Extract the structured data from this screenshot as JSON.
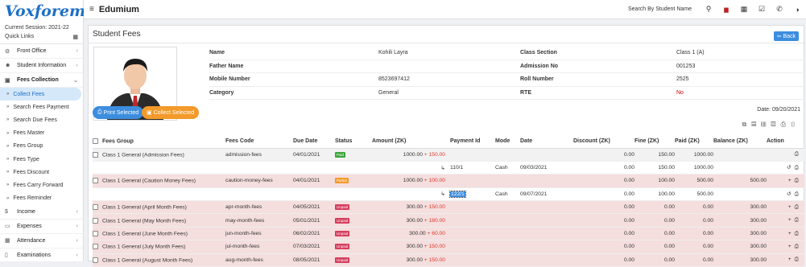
{
  "brand": {
    "logo": "Voxforem",
    "session": "Current Session: 2021-22",
    "quick_links": "Quick Links"
  },
  "sidebar": {
    "items": [
      {
        "label": "Front Office",
        "icon": "briefcase-icon"
      },
      {
        "label": "Student Information",
        "icon": "user-icon"
      },
      {
        "label": "Fees Collection",
        "icon": "money-icon"
      }
    ],
    "sub": [
      "Collect Fees",
      "Search Fees Payment",
      "Search Due Fees",
      "Fees Master",
      "Fees Group",
      "Fees Type",
      "Fees Discount",
      "Fees Carry Forward",
      "Fees Reminder"
    ],
    "more": [
      {
        "label": "Income",
        "icon": "dollar-icon"
      },
      {
        "label": "Expenses",
        "icon": "credit-card-icon"
      },
      {
        "label": "Attendance",
        "icon": "calendar-icon"
      },
      {
        "label": "Examinations",
        "icon": "book-icon"
      }
    ]
  },
  "topbar": {
    "app_name": "Edumium",
    "search": "Search By Student Name"
  },
  "panel": {
    "title": "Student Fees",
    "back": "Back",
    "print_selected": "Print Selected",
    "collect_selected": "Collect Selected",
    "date": "Date: 09/20/2021"
  },
  "student": [
    [
      "Name",
      "Kohili Layra",
      "Class Section",
      "Class 1 (A)"
    ],
    [
      "Father Name",
      "",
      "Admission No",
      "001253"
    ],
    [
      "Mobile Number",
      "8523697412",
      "Roll Number",
      "2525"
    ],
    [
      "Category",
      "General",
      "RTE",
      "No"
    ]
  ],
  "table": {
    "headers": [
      "Fees Group",
      "Fees Code",
      "Due Date",
      "Status",
      "Amount (ZK)",
      "Payment Id",
      "Mode",
      "Date",
      "Discount (ZK)",
      "Fine (ZK)",
      "Paid (ZK)",
      "Balance (ZK)",
      "Action"
    ],
    "rows": [
      {
        "cls": "grey",
        "check": true,
        "group": "Class 1 General (Admission Fees)",
        "code": "admission-fees",
        "due": "04/01/2021",
        "status": "Paid",
        "stype": "paid",
        "amount": "1000.00",
        "fine_add": "+ 150.00",
        "pid": "",
        "mode": "",
        "date": "",
        "disc": "0.00",
        "fine": "150.00",
        "paid": "1000.00",
        "bal": "",
        "act": "⎙"
      },
      {
        "cls": "",
        "check": false,
        "group": "",
        "code": "",
        "due": "",
        "status": "",
        "stype": "",
        "amount": "",
        "fine_add": "",
        "pid": "110/1",
        "mode": "Cash",
        "date": "09/03/2021",
        "disc": "0.00",
        "fine": "150.00",
        "paid": "1000.00",
        "bal": "",
        "act": "↺ ⎙"
      },
      {
        "cls": "pink",
        "check": true,
        "group": "Class 1 General (Caution Money Fees)",
        "code": "caution-money-fees",
        "due": "04/01/2021",
        "status": "Partial",
        "stype": "partial",
        "amount": "1000.00",
        "fine_add": "+ 100.00",
        "pid": "",
        "mode": "",
        "date": "",
        "disc": "0.00",
        "fine": "100.00",
        "paid": "500.00",
        "bal": "500.00",
        "act": "+ ⎙"
      },
      {
        "cls": "",
        "check": false,
        "group": "",
        "code": "",
        "due": "",
        "status": "",
        "stype": "",
        "amount": "",
        "fine_add": "",
        "pid": "122/1",
        "mode": "Cash",
        "date": "09/07/2021",
        "disc": "0.00",
        "fine": "100.00",
        "paid": "500.00",
        "bal": "",
        "act": "↺ ⎙",
        "hl": true
      },
      {
        "cls": "pink",
        "check": true,
        "group": "Class 1 General (April Month Fees)",
        "code": "apr-month-fees",
        "due": "04/05/2021",
        "status": "Unpaid",
        "stype": "unpaid",
        "amount": "300.00",
        "fine_add": "+ 150.00",
        "pid": "",
        "mode": "",
        "date": "",
        "disc": "0.00",
        "fine": "0.00",
        "paid": "0.00",
        "bal": "300.00",
        "act": "+ ⎙"
      },
      {
        "cls": "pink",
        "check": true,
        "group": "Class 1 General (May Month Fees)",
        "code": "may-month-fees",
        "due": "05/01/2021",
        "status": "Unpaid",
        "stype": "unpaid",
        "amount": "300.00",
        "fine_add": "+ 180.00",
        "pid": "",
        "mode": "",
        "date": "",
        "disc": "0.00",
        "fine": "0.00",
        "paid": "0.00",
        "bal": "300.00",
        "act": "+ ⎙"
      },
      {
        "cls": "pink",
        "check": true,
        "group": "Class 1 General (June Month Fees)",
        "code": "jun-month-fees",
        "due": "06/02/2021",
        "status": "Unpaid",
        "stype": "unpaid",
        "amount": "300.00",
        "fine_add": "+ 60.00",
        "pid": "",
        "mode": "",
        "date": "",
        "disc": "0.00",
        "fine": "0.00",
        "paid": "0.00",
        "bal": "300.00",
        "act": "+ ⎙"
      },
      {
        "cls": "pink",
        "check": true,
        "group": "Class 1 General (July Month Fees)",
        "code": "jul-month-fees",
        "due": "07/03/2021",
        "status": "Unpaid",
        "stype": "unpaid",
        "amount": "300.00",
        "fine_add": "+ 150.00",
        "pid": "",
        "mode": "",
        "date": "",
        "disc": "0.00",
        "fine": "0.00",
        "paid": "0.00",
        "bal": "300.00",
        "act": "+ ⎙"
      },
      {
        "cls": "pink",
        "check": true,
        "group": "Class 1 General (August Month Fees)",
        "code": "aug-month-fees",
        "due": "08/05/2021",
        "status": "Unpaid",
        "stype": "unpaid",
        "amount": "300.00",
        "fine_add": "+ 150.00",
        "pid": "",
        "mode": "",
        "date": "",
        "disc": "0.00",
        "fine": "0.00",
        "paid": "0.00",
        "bal": "300.00",
        "act": "+ ⎙"
      }
    ]
  }
}
